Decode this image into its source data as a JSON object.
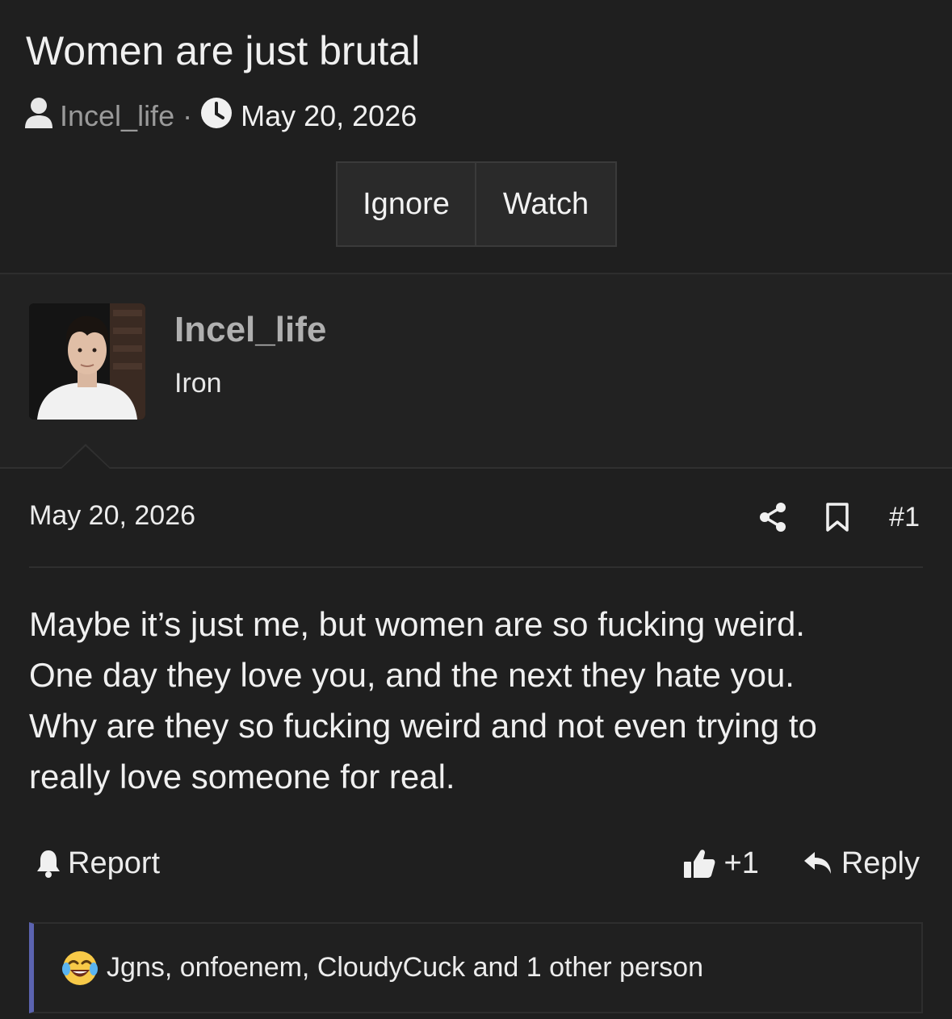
{
  "thread": {
    "title": "Women are just brutal",
    "author": "Incel_life",
    "separator": "·",
    "date": "May 20, 2026"
  },
  "buttons": {
    "ignore": "Ignore",
    "watch": "Watch"
  },
  "user": {
    "name": "Incel_life",
    "title": "Iron"
  },
  "post": {
    "date": "May 20, 2026",
    "number": "#1",
    "body": [
      "Maybe it’s just me, but women are so fucking weird.",
      "One day they love you, and the next they hate you.",
      "Why are they so fucking weird and not even trying to",
      "really love someone for real."
    ]
  },
  "actions": {
    "report": "Report",
    "like": "+1",
    "reply": "Reply"
  },
  "reactions": {
    "text": "Jgns, onfoenem, CloudyCuck and 1 other person",
    "emoji": "laughing-crying-icon"
  },
  "colors": {
    "background": "#1f1f1f",
    "accent_bar": "#5b63b0",
    "muted": "#9a9a9a"
  }
}
